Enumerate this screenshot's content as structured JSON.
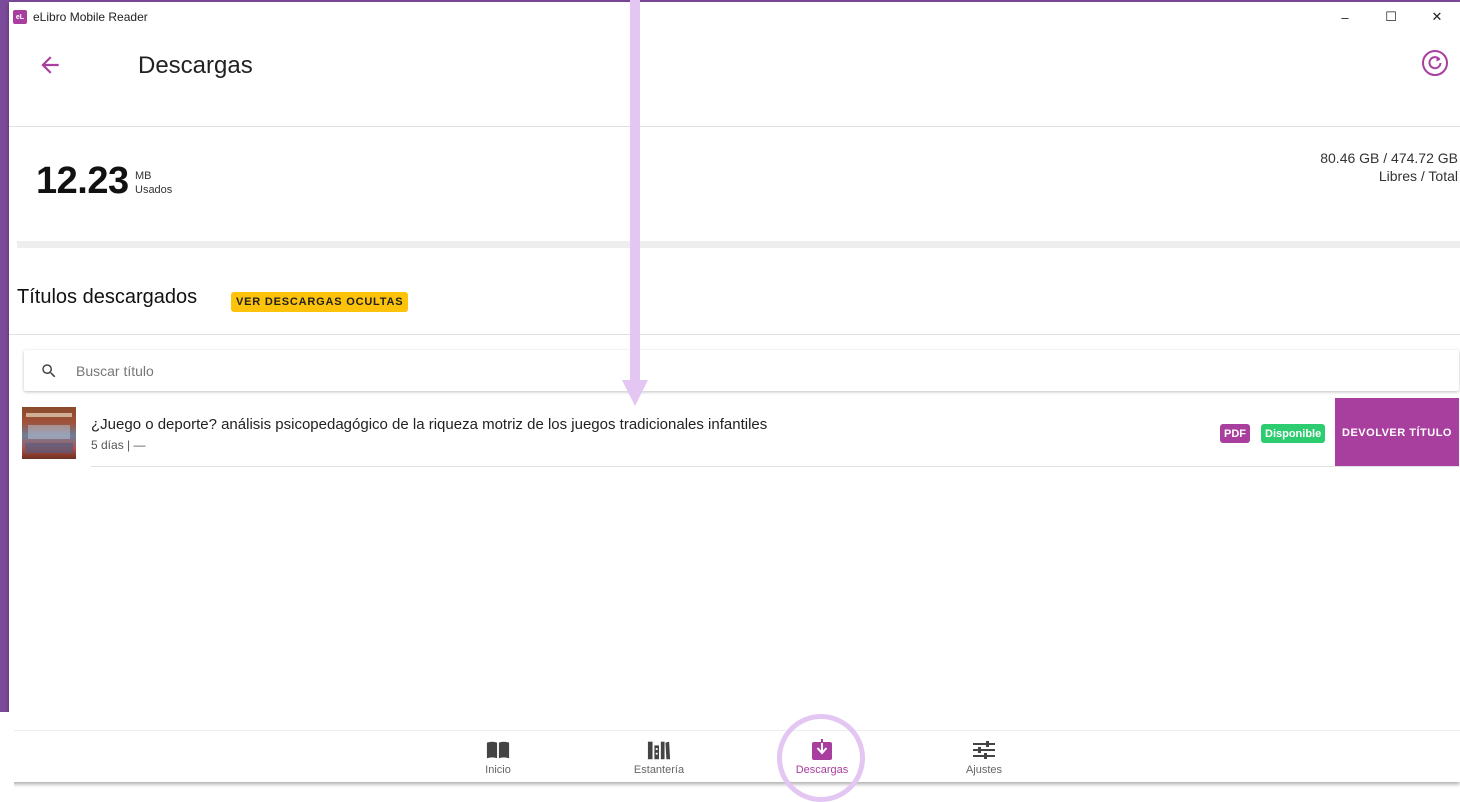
{
  "window": {
    "app_title": "eLibro Mobile Reader",
    "logo_text": "eL",
    "minimize": "–",
    "maximize": "☐",
    "close": "✕"
  },
  "header": {
    "title": "Descargas",
    "back_icon": "arrow-left-icon",
    "refresh_icon": "refresh-icon",
    "accent_color": "#a83f9e"
  },
  "storage": {
    "used_value": "12.23",
    "used_unit": "MB",
    "used_label": "Usados",
    "free_total_value": "80.46 GB / 474.72 GB",
    "free_total_label": "Libres / Total"
  },
  "downloads": {
    "section_title": "Títulos descargados",
    "hidden_button": "VER DESCARGAS OCULTAS",
    "search_placeholder": "Buscar título",
    "items": [
      {
        "title": "¿Juego o deporte? análisis psicopedagógico de la riqueza motriz de los juegos tradicionales infantiles",
        "meta": "5 días | —",
        "format_badge": "PDF",
        "status_badge": "Disponible",
        "action": "DEVOLVER TÍTULO"
      }
    ]
  },
  "bottom_nav": {
    "items": [
      {
        "label": "Inicio",
        "icon": "book-open-icon"
      },
      {
        "label": "Estantería",
        "icon": "bookshelf-icon"
      },
      {
        "label": "Descargas",
        "icon": "download-icon",
        "active": true
      },
      {
        "label": "Ajustes",
        "icon": "sliders-icon"
      }
    ]
  }
}
